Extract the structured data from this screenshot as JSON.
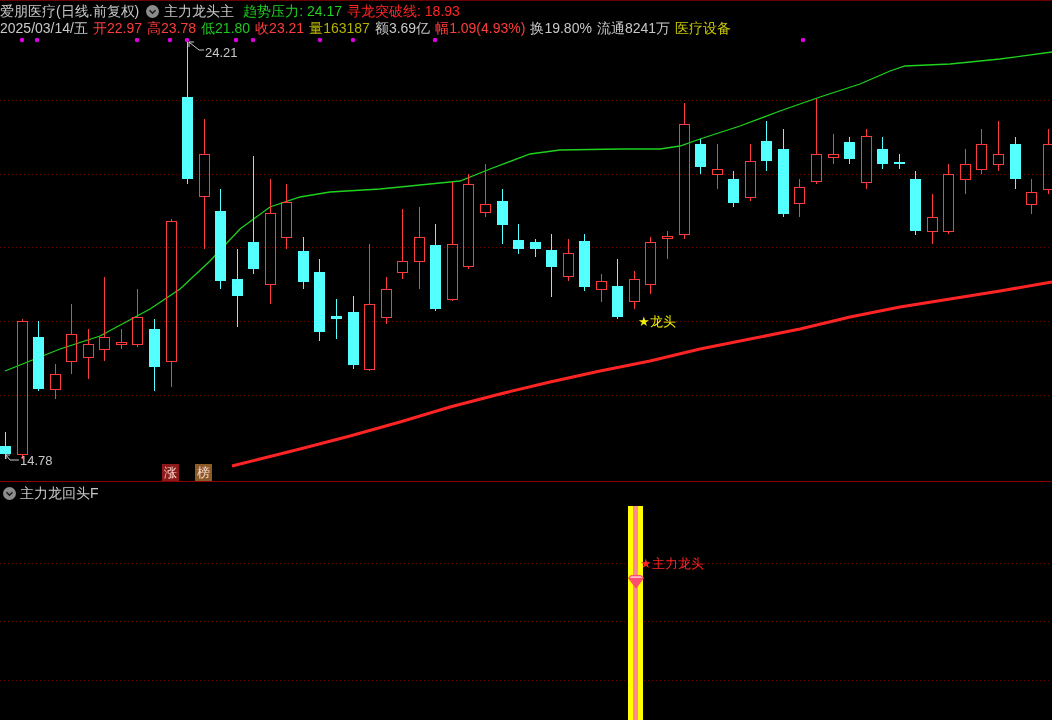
{
  "main_chart": {
    "title": "爱朋医疗(日线.前复权)",
    "indicator_name": "主力龙头主",
    "indicator_values": [
      {
        "label": "趋势压力: 24.17",
        "color": "#1ed21e"
      },
      {
        "label": "寻龙突破线: 18.93",
        "color": "#ff2424"
      }
    ],
    "quote": [
      {
        "text": "2025/03/14/五",
        "color": "#c8c8c8"
      },
      {
        "text": "开22.97",
        "color": "#ff3c3c"
      },
      {
        "text": "高23.78",
        "color": "#ff3c3c"
      },
      {
        "text": "低21.80",
        "color": "#1ec81e"
      },
      {
        "text": "收23.21",
        "color": "#ff3c3c"
      },
      {
        "text": "量163187",
        "color": "#b4b400"
      },
      {
        "text": "额3.69亿",
        "color": "#c8c8c8"
      },
      {
        "text": "幅1.09(4.93%)",
        "color": "#ff3c3c"
      },
      {
        "text": "换19.80%",
        "color": "#c8c8c8"
      },
      {
        "text": "流通8241万",
        "color": "#c8c8c8"
      },
      {
        "text": "医疗设备",
        "color": "#c8c800"
      }
    ],
    "high_label": "24.21",
    "low_label": "14.78",
    "signal_label": "★龙头",
    "tags": [
      {
        "label": "涨",
        "color": "#8c1a1a"
      },
      {
        "label": "榜",
        "color": "#8c5a28"
      }
    ]
  },
  "sub_chart": {
    "title": "主力龙回头F",
    "signal_label": "★主力龙头"
  }
}
